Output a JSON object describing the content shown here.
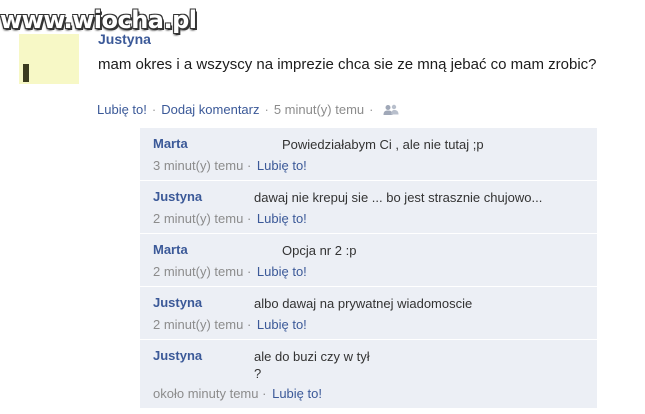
{
  "watermark": "www.wiocha.pl",
  "post": {
    "author": "Justyna",
    "text": "mam okres i a wszyscy na imprezie chca sie ze mną jebać co mam zrobic?",
    "like": "Lubię to!",
    "comment": "Dodaj komentarz",
    "time": "5 minut(y) temu",
    "separator": "·",
    "audience_icon": "people-icon"
  },
  "comments": [
    {
      "author": "Marta",
      "text": "Powiedziałabym Ci , ale nie tutaj ;p",
      "time": "3 minut(y) temu",
      "like": "Lubię to!"
    },
    {
      "author": "Justyna",
      "text": "dawaj nie krepuj sie ... bo jest strasznie chujowo...",
      "time": "2 minut(y) temu",
      "like": "Lubię to!"
    },
    {
      "author": "Marta",
      "text": "Opcja nr 2 :p",
      "time": "2 minut(y) temu",
      "like": "Lubię to!"
    },
    {
      "author": "Justyna",
      "text": "albo dawaj na prywatnej wiadomoscie",
      "time": "2 minut(y) temu",
      "like": "Lubię to!"
    },
    {
      "author": "Justyna",
      "text": "ale do buzi czy w tył\n?",
      "time": "około minuty temu",
      "like": "Lubię to!"
    }
  ],
  "colors": {
    "link": "#3b5998",
    "comment_bg": "#eceff5",
    "meta": "#8c8c8c"
  }
}
